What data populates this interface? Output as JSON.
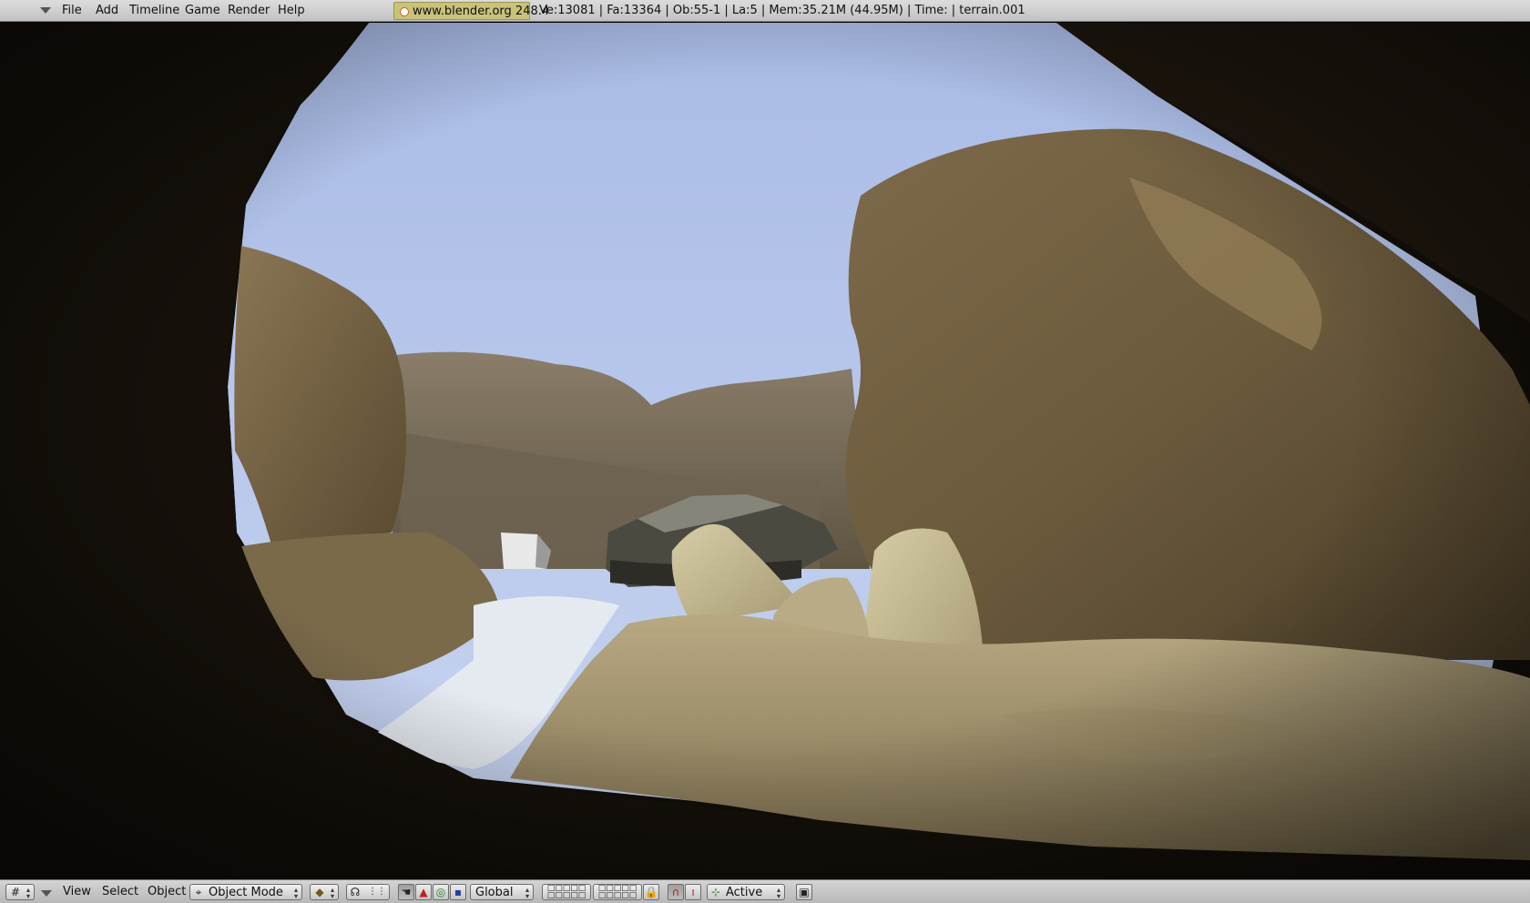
{
  "topbar": {
    "menus": [
      "File",
      "Add",
      "Timeline",
      "Game",
      "Render",
      "Help"
    ],
    "badge": "www.blender.org 248.4",
    "stats": "Ve:13081 | Fa:13364 | Ob:55-1 | La:5  | Mem:35.21M (44.95M)  | Time: | terrain.001"
  },
  "viewport": {
    "scene": "3D game view of a rocky desert canyon seen through a cave opening",
    "sky_color": "#bcc9ec",
    "rock_color": "#8a7755",
    "snow_color": "#e6ecf2"
  },
  "bottombar": {
    "menus": [
      "View",
      "Select",
      "Object"
    ],
    "mode": "Object Mode",
    "orientation": "Global",
    "snap_target": "Active",
    "icons": [
      "grid-icon",
      "draw-type-icon",
      "hand-icon",
      "arrow-icon",
      "circle-icon",
      "square-icon",
      "lock-icon",
      "magnet-icon",
      "render-icon"
    ]
  }
}
